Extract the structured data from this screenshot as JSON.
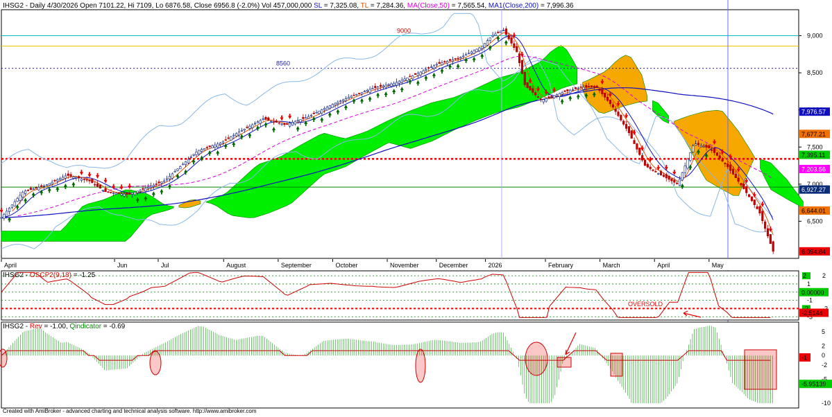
{
  "app": {
    "footer": "Created with AmiBroker - advanced charting and technical analysis software. http://www.amibroker.com"
  },
  "colors": {
    "cloud_bull": "#00ee00",
    "cloud_bear": "#f6a800",
    "ma50": "#dd00dd",
    "ma200": "#1010c0",
    "tl": "#e05000",
    "arrow_up": "#006600",
    "arrow_down": "#ee0000",
    "support": "#ee0000",
    "resistance_9000": "#00c0c0",
    "level_8560": "#2020a0"
  },
  "chart_data": [
    {
      "id": "price",
      "type": "candlestick",
      "title": "IHSG2 - Daily 4/30/2026 Open 7101.22, Hi 7109, Lo 6876.58, Close 6956.8 (-2.0%) Vol 457,000,000",
      "header_parts": [
        {
          "text": "IHSG2 - Daily 4/30/2026 Open 7101.22, Hi 7109, Lo 6876.58, Close 6956.8 (-2.0%) Vol 457,000,000 ",
          "color": "#000000"
        },
        {
          "text": "SL",
          "color": "#1010c0"
        },
        {
          "text": " = 7,325.08, ",
          "color": "#000000"
        },
        {
          "text": "TL",
          "color": "#e05000"
        },
        {
          "text": " = 7,284.36, ",
          "color": "#000000"
        },
        {
          "text": "MA(Close,50)",
          "color": "#dd00dd"
        },
        {
          "text": " = 7,565.54, ",
          "color": "#000000"
        },
        {
          "text": "MA1(Close,200)",
          "color": "#1010c0"
        },
        {
          "text": " = 7,996.36",
          "color": "#000000"
        }
      ],
      "y_ticks": [
        6500,
        7000,
        7500,
        8000,
        8500,
        9000
      ],
      "y_tick_labels": [
        "6,500",
        "7,000",
        "7,500",
        "8,000",
        "8,500",
        "9,000"
      ],
      "ylim": [
        6000,
        9350
      ],
      "x_labels": [
        "April",
        "Jun",
        "Jul",
        "August",
        "September",
        "October",
        "November",
        "December",
        "2026",
        "February",
        "March",
        "April",
        "May"
      ],
      "x_label_pos": [
        0,
        2.1,
        2.9,
        4.1,
        5.1,
        6.1,
        7.1,
        8.0,
        8.9,
        10.0,
        11.0,
        12.0,
        13.0
      ],
      "levels": [
        {
          "label": "9000",
          "value": 9000,
          "color": "#00c0c0",
          "style": "solid"
        },
        {
          "label": "",
          "value": 8860,
          "color": "#e8c800",
          "style": "solid"
        },
        {
          "label": "8560",
          "value": 8560,
          "color": "#2020a0",
          "style": "dotted"
        },
        {
          "label": "",
          "value": 7340,
          "color": "#ee0000",
          "style": "dotted"
        },
        {
          "label": "",
          "value": 6960,
          "color": "#008800",
          "style": "solid"
        }
      ],
      "price_tags": [
        {
          "text": "7,976.57",
          "value": 7976.57,
          "bg": "#1010c0",
          "fg": "#ffffff"
        },
        {
          "text": "7,677.21",
          "value": 7677.21,
          "bg": "#f07000",
          "fg": "#000000"
        },
        {
          "text": "7,395.11",
          "value": 7395.11,
          "bg": "#00cc00",
          "fg": "#000000"
        },
        {
          "text": "7,203.56",
          "value": 7203.56,
          "bg": "#ff00ff",
          "fg": "#ffffff"
        },
        {
          "text": "6,927.27",
          "value": 6927.27,
          "bg": "#0a2d7a",
          "fg": "#ffffff"
        },
        {
          "text": "6,644.01",
          "value": 6644.01,
          "bg": "#f07000",
          "fg": "#000000"
        },
        {
          "text": "6,094.84",
          "value": 6094.84,
          "bg": "#ee0000",
          "fg": "#000000"
        }
      ],
      "close_path": [
        [
          0,
          6550
        ],
        [
          0.4,
          6900
        ],
        [
          0.8,
          6980
        ],
        [
          1.2,
          7120
        ],
        [
          1.6,
          7050
        ],
        [
          1.9,
          6900
        ],
        [
          2.3,
          6860
        ],
        [
          2.6,
          6930
        ],
        [
          3.0,
          7050
        ],
        [
          3.3,
          7250
        ],
        [
          3.6,
          7450
        ],
        [
          4.0,
          7550
        ],
        [
          4.4,
          7720
        ],
        [
          4.8,
          7880
        ],
        [
          5.2,
          7800
        ],
        [
          5.6,
          7900
        ],
        [
          6.0,
          8050
        ],
        [
          6.4,
          8180
        ],
        [
          6.8,
          8290
        ],
        [
          7.2,
          8360
        ],
        [
          7.6,
          8480
        ],
        [
          8.0,
          8620
        ],
        [
          8.4,
          8700
        ],
        [
          8.8,
          8850
        ],
        [
          9.0,
          9000
        ],
        [
          9.2,
          9080
        ],
        [
          9.45,
          8780
        ],
        [
          9.6,
          8330
        ],
        [
          9.9,
          8130
        ],
        [
          10.3,
          8240
        ],
        [
          10.6,
          8300
        ],
        [
          10.9,
          8320
        ],
        [
          11.2,
          8050
        ],
        [
          11.5,
          7700
        ],
        [
          11.8,
          7250
        ],
        [
          12.1,
          7120
        ],
        [
          12.4,
          7000
        ],
        [
          12.7,
          7550
        ],
        [
          13.0,
          7480
        ],
        [
          13.3,
          7250
        ],
        [
          13.6,
          6950
        ],
        [
          13.9,
          6620
        ],
        [
          14.15,
          6094.84
        ]
      ]
    },
    {
      "id": "oscillator",
      "type": "line",
      "title": "IHSG2 - OSCP2(9,18) = -1.25",
      "title_parts": [
        {
          "text": "IHSG2 - ",
          "color": "#000000"
        },
        {
          "text": "OSCP2(9,18)",
          "color": "#ee0000"
        },
        {
          "text": " = -1.25",
          "color": "#000000"
        }
      ],
      "y_ticks": [
        2,
        1,
        0,
        -1,
        -2,
        -3
      ],
      "y_tick_labels": [
        "2",
        "1",
        "0",
        "-1",
        "-2",
        "-3"
      ],
      "ylim": [
        -3.4,
        2.6
      ],
      "annotation": "OVERSOLD",
      "tags": [
        {
          "text": "0.00000",
          "value": 0,
          "bg": "#00cc00",
          "fg": "#000000"
        },
        {
          "text": "-2.5144",
          "value": -2.5144,
          "bg": "#ee0000",
          "fg": "#000000"
        }
      ]
    },
    {
      "id": "reversal",
      "type": "bar",
      "title": "IHSG2 - Rev = -1.00, Qindicator = -0.69",
      "title_parts": [
        {
          "text": "IHSG2 - ",
          "color": "#000000"
        },
        {
          "text": "Rev",
          "color": "#ee0000"
        },
        {
          "text": " = -1.00, ",
          "color": "#000000"
        },
        {
          "text": "Qindicator",
          "color": "#008800"
        },
        {
          "text": " = -0.69",
          "color": "#000000"
        }
      ],
      "y_ticks": [
        5,
        2,
        0,
        -2,
        -5,
        -10
      ],
      "y_tick_labels": [
        "5",
        "2",
        "0",
        "-2",
        "-5",
        "-10"
      ],
      "ylim": [
        -11,
        7
      ],
      "tags": [
        {
          "text": "-1",
          "value": -0.4,
          "bg": "#ee0000",
          "fg": "#000000"
        },
        {
          "text": "-5.95139",
          "value": -5.95139,
          "bg": "#00cc00",
          "fg": "#000000"
        }
      ]
    }
  ]
}
